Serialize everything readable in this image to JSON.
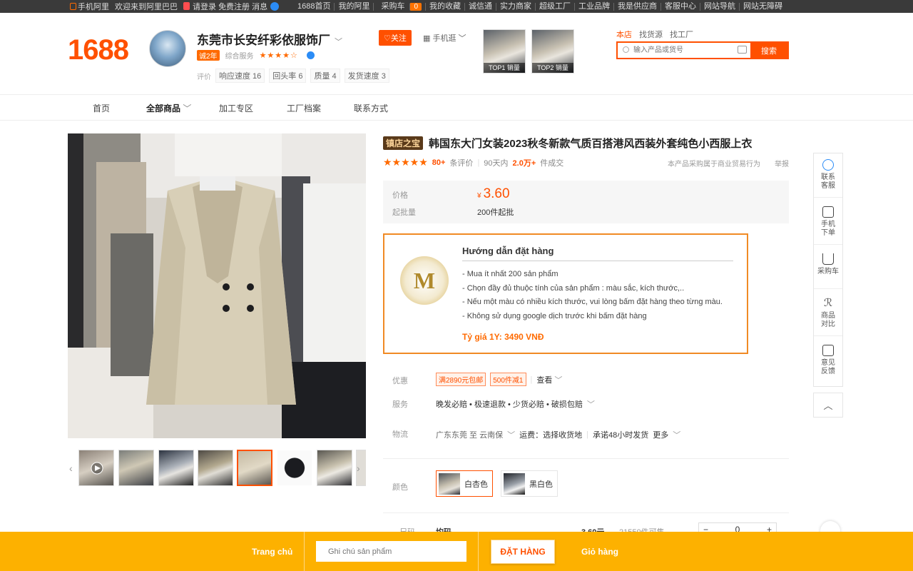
{
  "topbar": {
    "mobile": "手机阿里",
    "welcome": "欢迎来到阿里巴巴",
    "login": "请登录",
    "register": "免费注册",
    "messages": "消息",
    "links": [
      "1688首页",
      "我的阿里",
      "采购车",
      "我的收藏",
      "诚信通",
      "实力商家",
      "超级工厂",
      "工业品牌",
      "我是供应商",
      "客服中心",
      "网站导航",
      "网站无障碍"
    ],
    "cart_count": "0"
  },
  "header": {
    "logo": "1688",
    "shop_name": "东莞市长安纤彩依服饰厂",
    "shop_year": "诚2年",
    "shop_level": "综合服务",
    "stars": "★★★★☆",
    "stats_label": "评价",
    "stats": [
      "响应速度 16",
      "回头率 6",
      "质量 4",
      "发货速度 3"
    ],
    "follow": "♡关注",
    "mobile_visit": "手机逛",
    "top1": "TOP1 销量",
    "top2": "TOP2 销量",
    "search_tabs": [
      "本店",
      "找货源",
      "找工厂"
    ],
    "search_placeholder": "输入产品或货号",
    "search_button": "搜索"
  },
  "nav": {
    "items": [
      "首页",
      "全部商品",
      "加工专区",
      "工厂档案",
      "联系方式"
    ]
  },
  "product": {
    "badge": "镇店之宝",
    "title": "韩国东大门女装2023秋冬新款气质百搭港风西装外套纯色小西服上衣",
    "stars": "★★★★★",
    "review_count": "80+",
    "review_label": "条评价",
    "sales_prefix": "90天内",
    "sales_value": "2.0万+",
    "sales_suffix": "件成交",
    "guarantee": "本产品采购属于商业贸易行为",
    "report": "举报",
    "price_label": "价格",
    "price_currency": "¥",
    "price": "3.60",
    "moq_label": "起批量",
    "moq": "200件起批"
  },
  "guide": {
    "title": "Hướng dẫn đặt hàng",
    "items": [
      "- Mua ít nhất 200 sản phẩm",
      "- Chọn đầy đủ thuộc tính của sản phẩm : màu sắc, kích thước,..",
      "- Nếu một màu có nhiều kích thước, vui lòng bấm đặt hàng theo từng màu.",
      "- Không sử dụng google dịch trước khi bấm đặt hàng"
    ],
    "rate": "Tỷ giá 1Y: 3490 VNĐ"
  },
  "rows": {
    "discount_label": "优惠",
    "discount_chips": [
      "满2890元包邮",
      "500件减1"
    ],
    "discount_more": "查看",
    "service_label": "服务",
    "service_value": "晚发必赔 • 极速退款 • 少货必赔 • 破损包赔",
    "logistics_label": "物流",
    "logistics_value": "广东东莞 至 云南保",
    "logistics_fee": "运费：选择收货地",
    "logistics_ship": "承诺48小时发货",
    "logistics_more": "更多",
    "color_label": "颜色",
    "colors": [
      "白杏色",
      "黑白色"
    ],
    "size_label": "尺码",
    "size_value": "均码",
    "size_price": "3.60元",
    "size_stock": "21550件可售",
    "qty": "0"
  },
  "sidebar": {
    "items": [
      "联系客服",
      "手机下单",
      "采购车",
      "商品对比",
      "意见反馈"
    ],
    "to_top": "︿"
  },
  "bottombar": {
    "home": "Trang chủ",
    "note_placeholder": "Ghi chú sản phẩm",
    "order": "ĐẶT HÀNG",
    "cart": "Giỏ hàng"
  },
  "colors": {
    "brand": "#ff5000",
    "guide_border": "#f08a24",
    "bottombar": "#fdb100"
  }
}
